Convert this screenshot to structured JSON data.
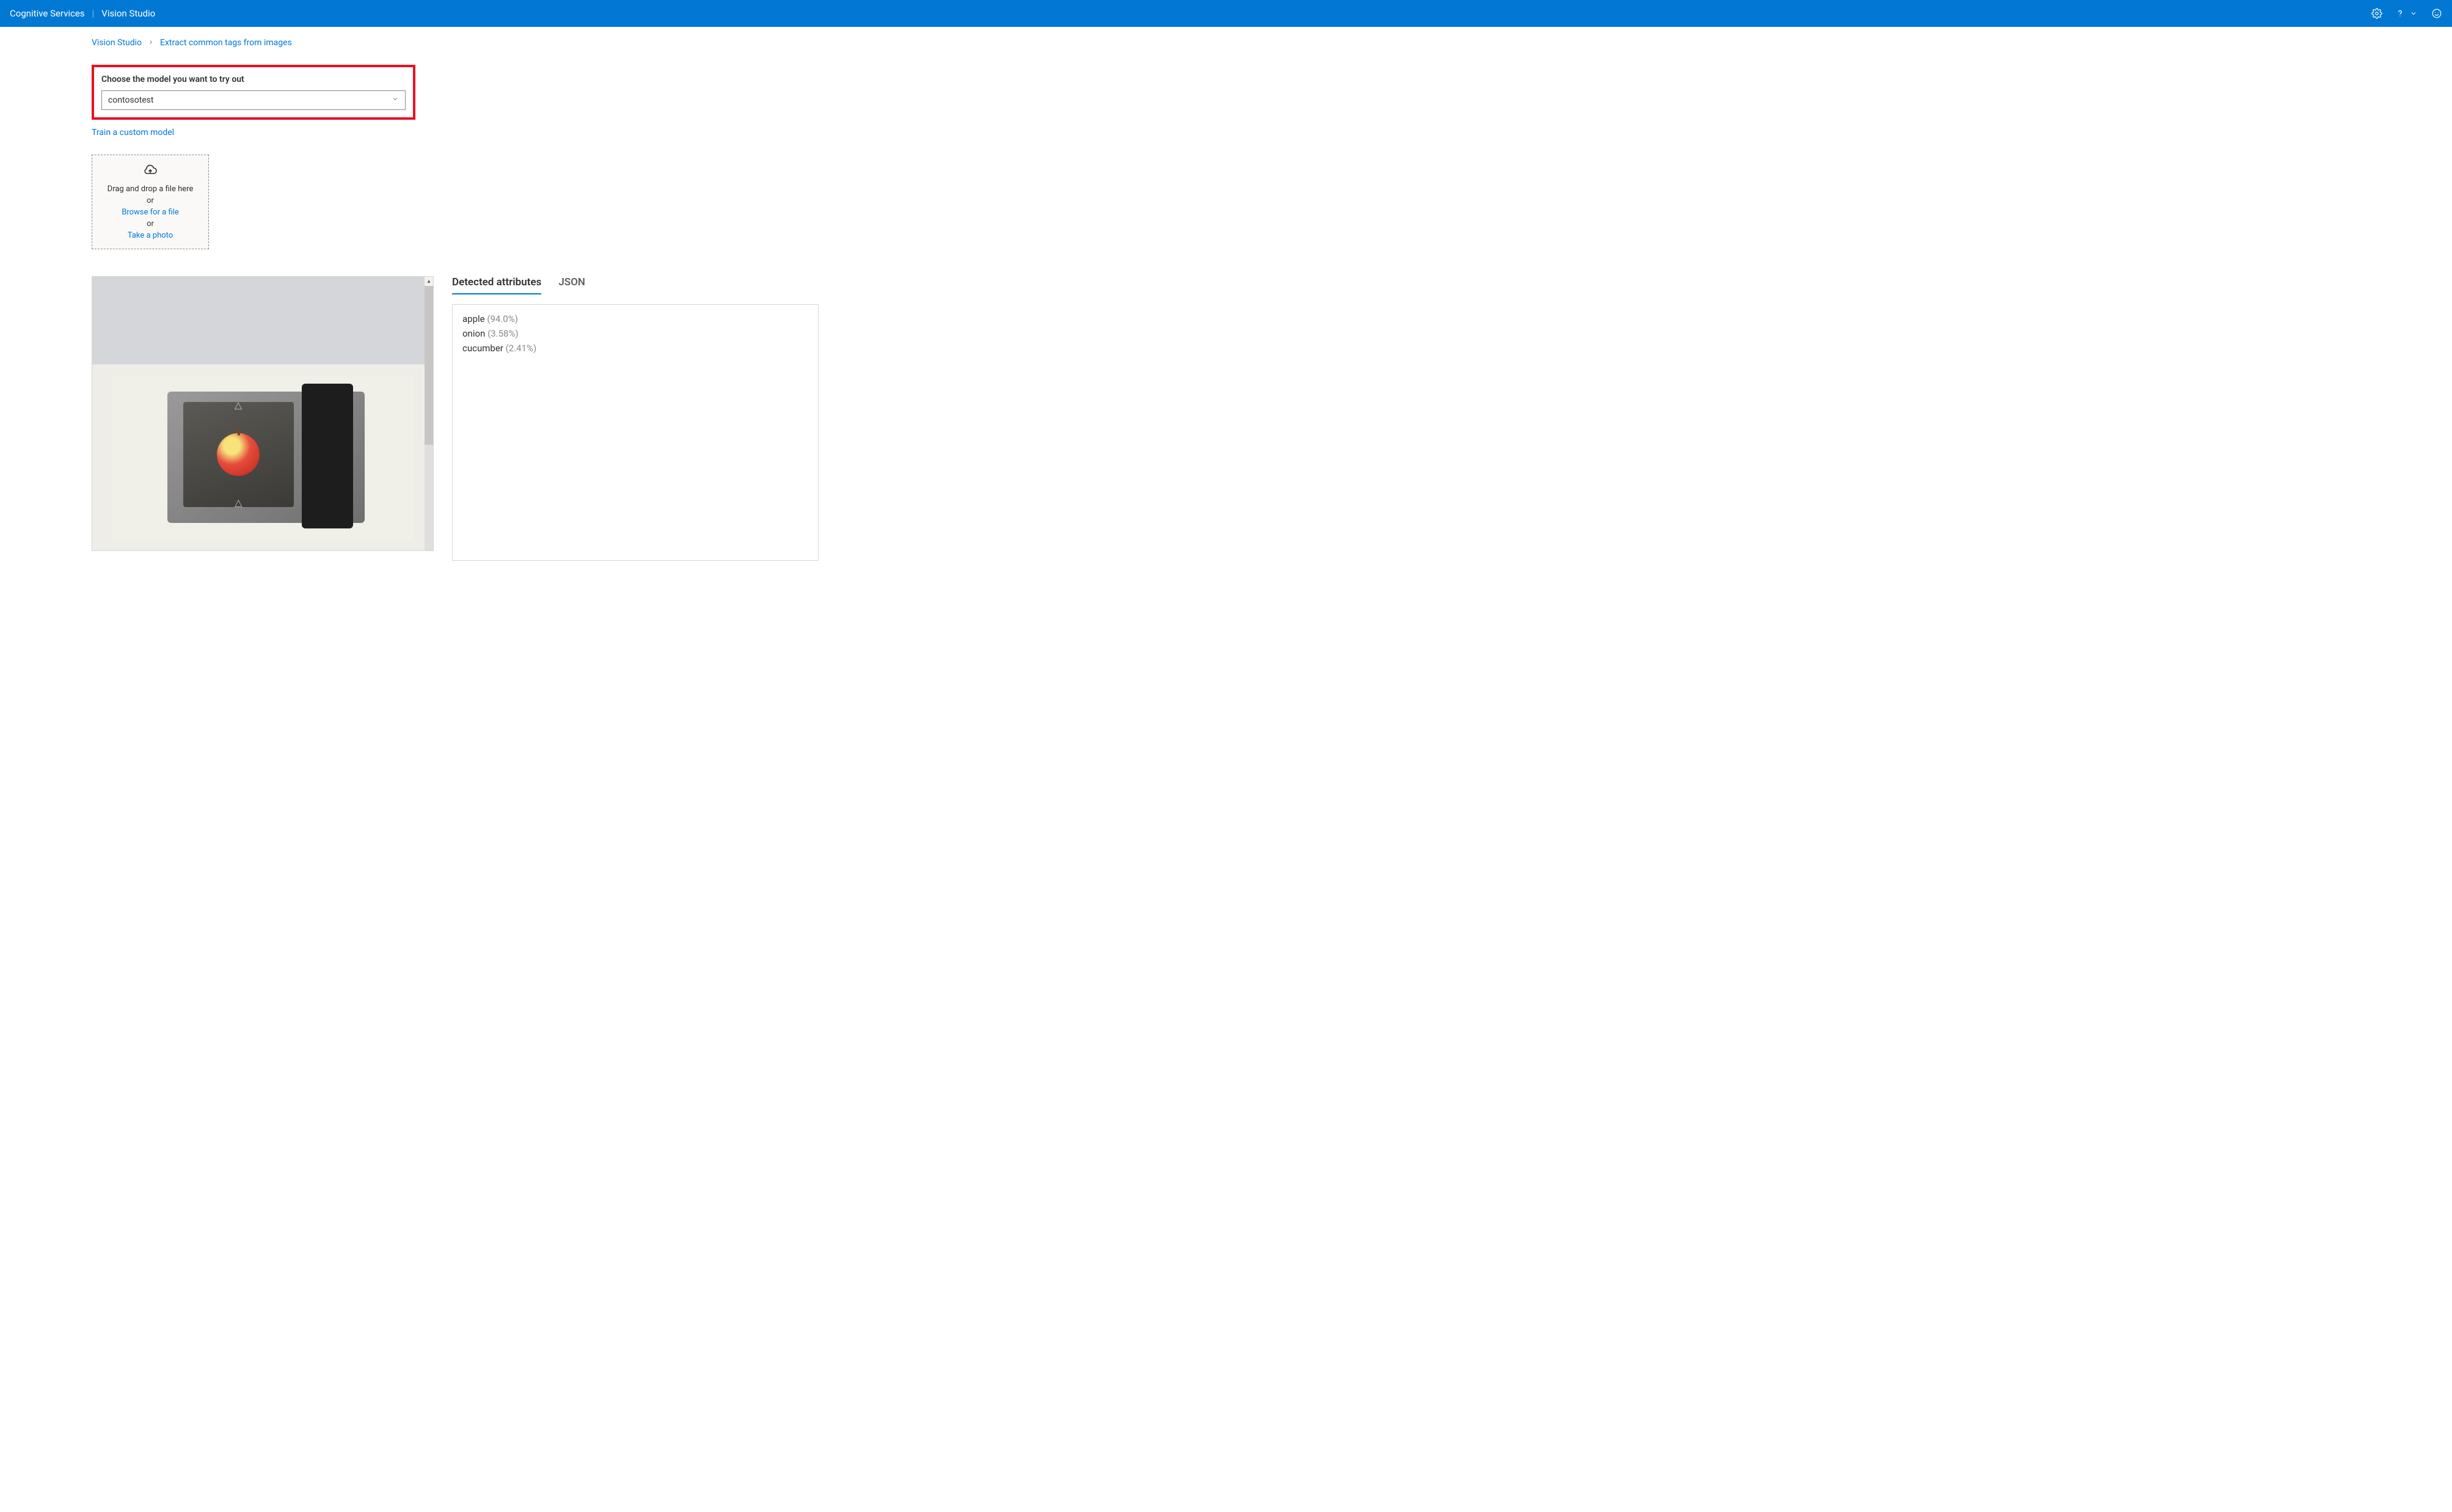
{
  "header": {
    "brand": "Cognitive Services",
    "product": "Vision Studio"
  },
  "breadcrumb": {
    "root": "Vision Studio",
    "current": "Extract common tags from images"
  },
  "model_chooser": {
    "label": "Choose the model you want to try out",
    "selected": "contosotest",
    "train_link": "Train a custom model"
  },
  "upload": {
    "drag_text": "Drag and drop a file here",
    "or1": "or",
    "browse": "Browse for a file",
    "or2": "or",
    "photo": "Take a photo"
  },
  "tabs": {
    "detected": "Detected attributes",
    "json": "JSON"
  },
  "results": [
    {
      "name": "apple",
      "score": "(94.0%)"
    },
    {
      "name": "onion",
      "score": "(3.58%)"
    },
    {
      "name": "cucumber",
      "score": "(2.41%)"
    }
  ]
}
